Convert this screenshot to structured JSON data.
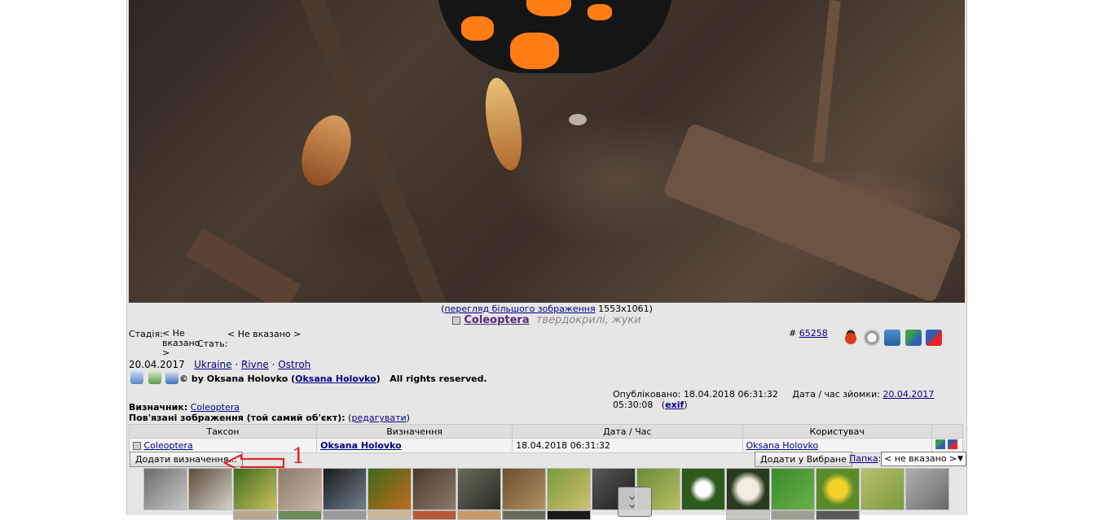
{
  "photo": {
    "caption_prefix": "(",
    "caption_link": "перегляд більшого зображення",
    "caption_size": "1553x1061)"
  },
  "taxon": {
    "name": "Coleoptera",
    "common": "твердокрилі, жуки"
  },
  "meta": {
    "stage_label": "Стадія:",
    "stage_value_1": "< Не",
    "stage_value_2": "вказано",
    "stage_value_3": ">",
    "sex_label": "Стать:",
    "sex_value": "< Не вказано >",
    "record_id_prefix": "#",
    "record_id": "65258",
    "date": "20.04.2017",
    "place_1": "Ukraine",
    "place_2": "Rivne",
    "place_3": "Ostroh",
    "sep": "·",
    "copyright_prefix": "© by",
    "author": "Oksana Holovko",
    "author_link": "Oksana Holovko",
    "rights": "All rights reserved.",
    "published_label": "Опубліковано:",
    "published_value": "18.04.2018 06:31:32",
    "shot_label": "Дата / час зйомки:",
    "shot_date": "20.04.2017",
    "shot_time": "05:30:08",
    "exif": "exif"
  },
  "ident": {
    "label": "Визначник:",
    "value": "Coleoptera",
    "related_label": "Пов'язані зображення (той самий об'єкт):",
    "edit": "редагувати"
  },
  "table": {
    "headers": [
      "Таксон",
      "Визначення",
      "Дата / Час",
      "Користувач"
    ],
    "rows": [
      {
        "taxon": "Coleoptera",
        "ident": "Oksana Holovko",
        "datetime": "18.04.2018 06:31:32",
        "user": "Oksana Holovko"
      }
    ]
  },
  "actions": {
    "add_ident": "Додати визначення...",
    "annotation_number": "1",
    "add_fav": "Додати у Вибране",
    "folder_label": "Папка",
    "folder_colon": ":",
    "folder_value": "< не вказано >"
  },
  "colors": {
    "link": "#00008b",
    "accent_red": "#e0262a",
    "bg": "#e6e6e6"
  }
}
